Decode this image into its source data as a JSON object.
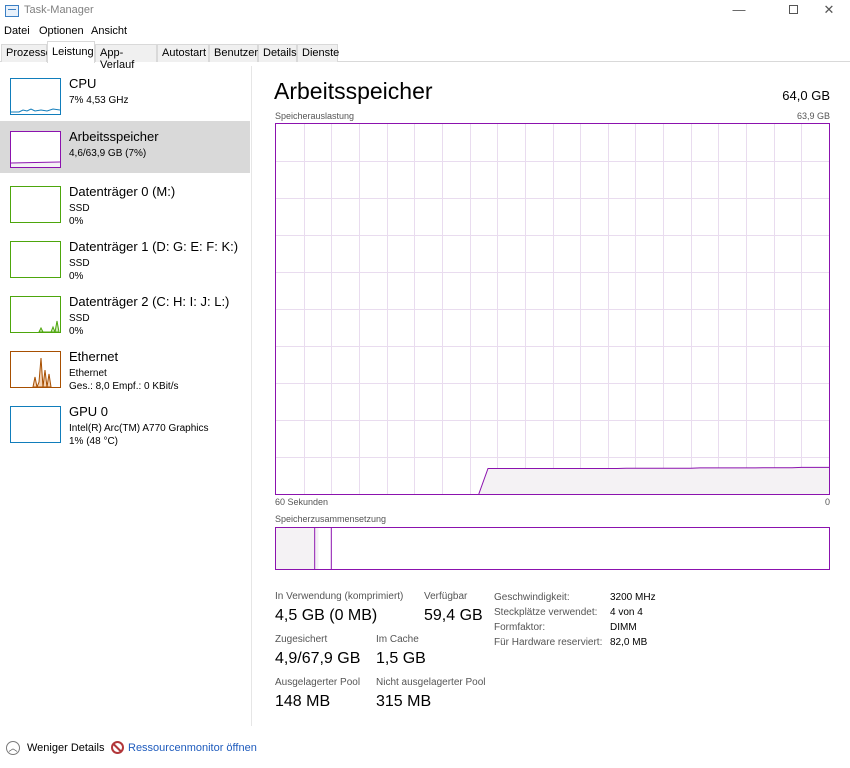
{
  "window": {
    "title": "Task-Manager",
    "minimize": "—",
    "close": "✕"
  },
  "menu": [
    "Datei",
    "Optionen",
    "Ansicht"
  ],
  "tabs": [
    "Prozesse",
    "Leistung",
    "App-Verlauf",
    "Autostart",
    "Benutzer",
    "Details",
    "Dienste"
  ],
  "active_tab": "Leistung",
  "sidebar": {
    "items": [
      {
        "title": "CPU",
        "lines": [
          "7% 4,53 GHz"
        ],
        "color": "#117dbb",
        "selected": false
      },
      {
        "title": "Arbeitsspeicher",
        "lines": [
          "4,6/63,9 GB (7%)"
        ],
        "color": "#8b12ae",
        "selected": true
      },
      {
        "title": "Datenträger 0 (M:)",
        "lines": [
          "SSD",
          "0%"
        ],
        "color": "#4da60c",
        "selected": false
      },
      {
        "title": "Datenträger 1 (D: G: E: F: K:)",
        "lines": [
          "SSD",
          "0%"
        ],
        "color": "#4da60c",
        "selected": false
      },
      {
        "title": "Datenträger 2 (C: H: I: J: L:)",
        "lines": [
          "SSD",
          "0%"
        ],
        "color": "#4da60c",
        "selected": false
      },
      {
        "title": "Ethernet",
        "lines": [
          "Ethernet",
          "Ges.: 8,0 Empf.: 0 KBit/s"
        ],
        "color": "#a74f01",
        "selected": false
      },
      {
        "title": "GPU 0",
        "lines": [
          "Intel(R) Arc(TM) A770 Graphics",
          "1% (48 °C)"
        ],
        "color": "#117dbb",
        "selected": false
      }
    ]
  },
  "main": {
    "title": "Arbeitsspeicher",
    "total": "64,0 GB",
    "graph_label": "Speicherauslastung",
    "graph_max": "63,9 GB",
    "graph_time": "60 Sekunden",
    "graph_zero": "0",
    "composition_label": "Speicherzusammensetzung",
    "accent": "#8b12ae"
  },
  "chart_data": {
    "type": "area",
    "x_window_seconds": 60,
    "ylim": [
      0,
      63.9
    ],
    "memory_usage_series": [
      0,
      0,
      0,
      0,
      0,
      0,
      0,
      0,
      0,
      0,
      0,
      0,
      0,
      0,
      0,
      0,
      0,
      0,
      0,
      0,
      0,
      0,
      0,
      4.4,
      4.4,
      4.4,
      4.4,
      4.4,
      4.4,
      4.4,
      4.4,
      4.4,
      4.4,
      4.4,
      4.4,
      4.4,
      4.4,
      4.4,
      4.45,
      4.45,
      4.45,
      4.45,
      4.45,
      4.45,
      4.45,
      4.45,
      4.5,
      4.5,
      4.5,
      4.5,
      4.5,
      4.5,
      4.5,
      4.55,
      4.55,
      4.55,
      4.55,
      4.6,
      4.6,
      4.6,
      4.6
    ],
    "composition": {
      "in_use_fraction": 0.07,
      "modified_fraction": 0.005,
      "standby_fraction": 0.025
    }
  },
  "stats": {
    "in_use_label": "In Verwendung (komprimiert)",
    "in_use_value": "4,5 GB (0 MB)",
    "available_label": "Verfügbar",
    "available_value": "59,4 GB",
    "committed_label": "Zugesichert",
    "committed_value": "4,9/67,9 GB",
    "cached_label": "Im Cache",
    "cached_value": "1,5 GB",
    "paged_label": "Ausgelagerter Pool",
    "paged_value": "148 MB",
    "nonpaged_label": "Nicht ausgelagerter Pool",
    "nonpaged_value": "315 MB"
  },
  "info": {
    "speed_label": "Geschwindigkeit:",
    "speed_value": "3200 MHz",
    "slots_label": "Steckplätze verwendet:",
    "slots_value": "4 von 4",
    "form_label": "Formfaktor:",
    "form_value": "DIMM",
    "reserved_label": "Für Hardware reserviert:",
    "reserved_value": "82,0 MB"
  },
  "footer": {
    "fewer_details": "Weniger Details",
    "open_monitor": "Ressourcenmonitor öffnen"
  }
}
